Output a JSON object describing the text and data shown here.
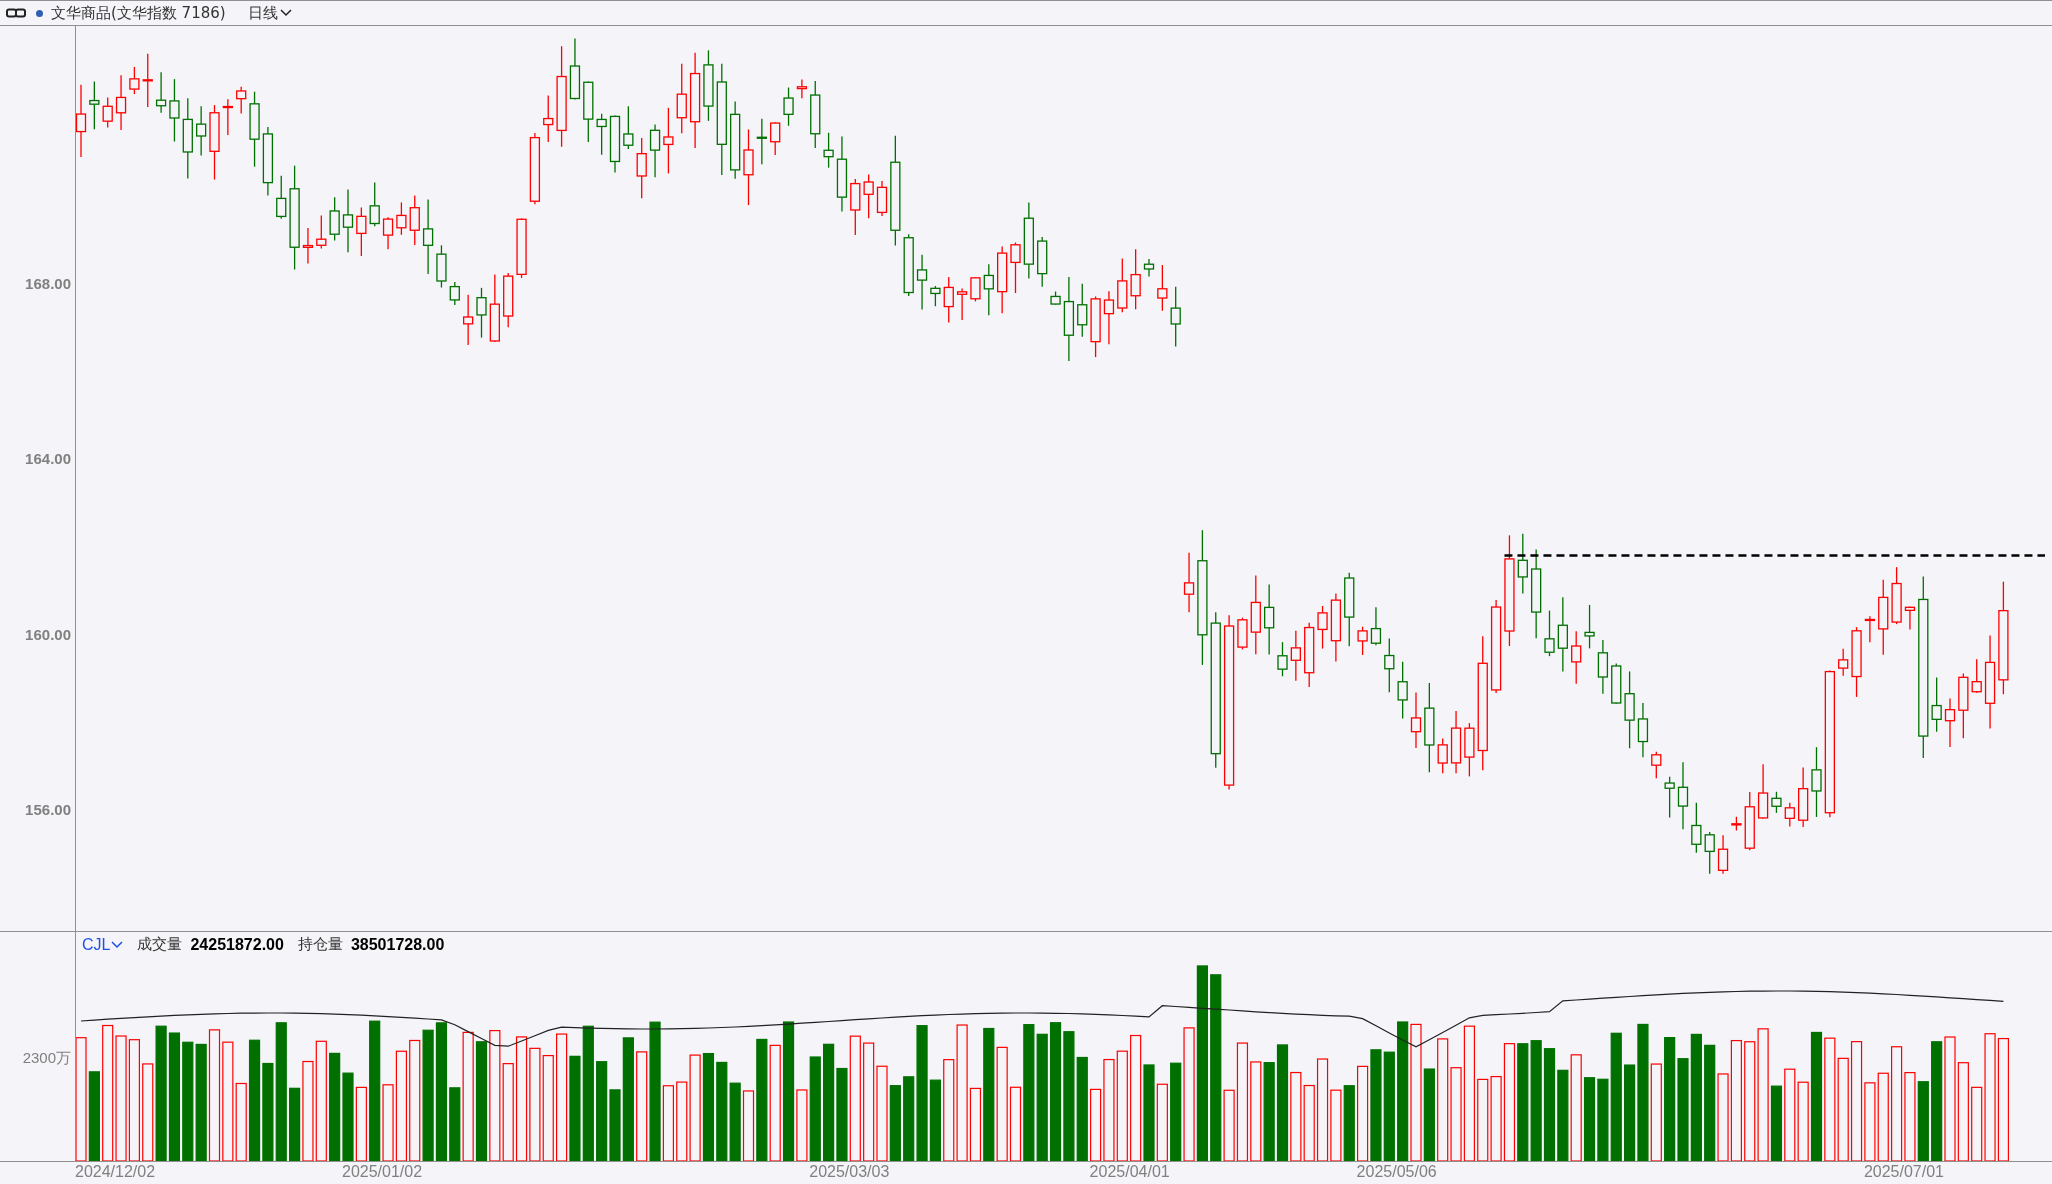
{
  "toolbar": {
    "title": "文华商品(文华指数 7186)",
    "period": "日线"
  },
  "price_chart": {
    "yaxis_labels": [
      "168.00",
      "164.00",
      "160.00",
      "156.00"
    ]
  },
  "indicator": {
    "name": "CJL",
    "volume_label": "成交量",
    "volume_value": "24251872.00",
    "oi_label": "持仓量",
    "oi_value": "38501728.00",
    "axis_label": "2300万"
  },
  "date_axis": {
    "labels": [
      "2024/12/02",
      "2025/01/02",
      "2025/03/03",
      "2025/04/01",
      "2025/05/06",
      "2025/07/01"
    ]
  }
}
